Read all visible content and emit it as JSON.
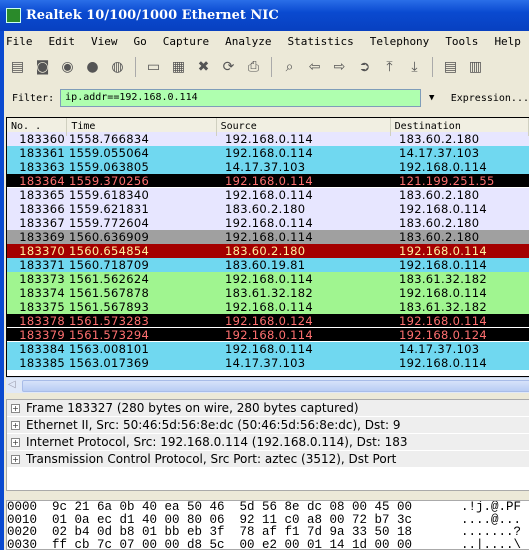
{
  "window": {
    "title": "Realtek 10/100/1000 Ethernet NIC"
  },
  "menu": [
    "File",
    "Edit",
    "View",
    "Go",
    "Capture",
    "Analyze",
    "Statistics",
    "Telephony",
    "Tools",
    "Help"
  ],
  "toolbar": [
    {
      "icon": "interfaces-icon",
      "g": "▤"
    },
    {
      "icon": "capture-options-icon",
      "g": "◙"
    },
    {
      "icon": "start-capture-icon",
      "g": "◉"
    },
    {
      "icon": "stop-capture-icon",
      "g": "●"
    },
    {
      "icon": "restart-capture-icon",
      "g": "◍"
    },
    {
      "sep": true
    },
    {
      "icon": "open-icon",
      "g": "▭"
    },
    {
      "icon": "save-icon",
      "g": "▦"
    },
    {
      "icon": "close-icon",
      "g": "✖"
    },
    {
      "icon": "reload-icon",
      "g": "⟳"
    },
    {
      "icon": "print-icon",
      "g": "⎙"
    },
    {
      "sep": true
    },
    {
      "icon": "find-icon",
      "g": "⌕"
    },
    {
      "icon": "back-icon",
      "g": "⇦"
    },
    {
      "icon": "forward-icon",
      "g": "⇨"
    },
    {
      "icon": "go-to-packet-icon",
      "g": "➲"
    },
    {
      "icon": "first-packet-icon",
      "g": "⤒"
    },
    {
      "icon": "last-packet-icon",
      "g": "⤓"
    },
    {
      "sep": true
    },
    {
      "icon": "colorize-icon",
      "g": "▤"
    },
    {
      "icon": "autoscroll-icon",
      "g": "▥"
    }
  ],
  "filter": {
    "label": "Filter:",
    "value": "ip.addr==192.168.0.114",
    "expression": "Expression..."
  },
  "columns": [
    "No. .",
    "Time",
    "Source",
    "Destination"
  ],
  "colors": {
    "tcp": "#e7e6ff",
    "udp": "#70d8f0",
    "black": "#000000",
    "black_text": "#ff7070",
    "gray": "#a0a0a0",
    "darkred": "#a40000",
    "darkred_text": "#fff0a0",
    "green": "#a0f590"
  },
  "packets": [
    {
      "no": "183360",
      "time": "1558.766834",
      "src": "192.168.0.114",
      "dst": "183.60.2.180",
      "style": "tcp"
    },
    {
      "no": "183361",
      "time": "1559.055064",
      "src": "192.168.0.114",
      "dst": "14.17.37.103",
      "style": "udp"
    },
    {
      "no": "183363",
      "time": "1559.063805",
      "src": "14.17.37.103",
      "dst": "192.168.0.114",
      "style": "udp"
    },
    {
      "no": "183364",
      "time": "1559.370256",
      "src": "192.168.0.114",
      "dst": "121.199.251.55",
      "style": "black"
    },
    {
      "no": "183365",
      "time": "1559.618340",
      "src": "192.168.0.114",
      "dst": "183.60.2.180",
      "style": "tcp"
    },
    {
      "no": "183366",
      "time": "1559.621831",
      "src": "183.60.2.180",
      "dst": "192.168.0.114",
      "style": "tcp"
    },
    {
      "no": "183367",
      "time": "1559.772604",
      "src": "192.168.0.114",
      "dst": "183.60.2.180",
      "style": "tcp"
    },
    {
      "no": "183369",
      "time": "1560.636909",
      "src": "192.168.0.114",
      "dst": "183.60.2.180",
      "style": "gray"
    },
    {
      "no": "183370",
      "time": "1560.654854",
      "src": "183.60.2.180",
      "dst": "192.168.0.114",
      "style": "darkred"
    },
    {
      "no": "183371",
      "time": "1560.718709",
      "src": "183.60.19.81",
      "dst": "192.168.0.114",
      "style": "udp"
    },
    {
      "no": "183373",
      "time": "1561.562624",
      "src": "192.168.0.114",
      "dst": "183.61.32.182",
      "style": "green"
    },
    {
      "no": "183374",
      "time": "1561.567878",
      "src": "183.61.32.182",
      "dst": "192.168.0.114",
      "style": "green"
    },
    {
      "no": "183375",
      "time": "1561.567893",
      "src": "192.168.0.114",
      "dst": "183.61.32.182",
      "style": "green"
    },
    {
      "no": "183378",
      "time": "1561.573283",
      "src": "192.168.0.124",
      "dst": "192.168.0.114",
      "style": "black"
    },
    {
      "no": "183379",
      "time": "1561.573294",
      "src": "192.168.0.114",
      "dst": "192.168.0.124",
      "style": "black"
    },
    {
      "no": "183384",
      "time": "1563.008101",
      "src": "192.168.0.114",
      "dst": "14.17.37.103",
      "style": "udp"
    },
    {
      "no": "183385",
      "time": "1563.017369",
      "src": "14.17.37.103",
      "dst": "192.168.0.114",
      "style": "udp"
    }
  ],
  "details": [
    "Frame 183327 (280 bytes on wire, 280 bytes captured)",
    "Ethernet II, Src: 50:46:5d:56:8e:dc (50:46:5d:56:8e:dc), Dst: 9",
    "Internet Protocol, Src: 192.168.0.114 (192.168.0.114), Dst: 183",
    "Transmission Control Protocol, Src Port: aztec (3512), Dst Port"
  ],
  "bytes": [
    {
      "off": "0000",
      "hex": "9c 21 6a 0b 40 ea 50 46  5d 56 8e dc 08 00 45 00",
      "ascii": ".!j.@.PF"
    },
    {
      "off": "0010",
      "hex": "01 0a ec d1 40 00 80 06  92 11 c0 a8 00 72 b7 3c",
      "ascii": "....@..."
    },
    {
      "off": "0020",
      "hex": "02 b4 0d b8 01 bb eb 3f  78 af f1 7d 9a 33 50 18",
      "ascii": ".......?"
    },
    {
      "off": "0030",
      "hex": "ff cb 7c 07 00 00 d8 5c  00 e2 00 01 14 1d 00 00",
      "ascii": "..|....\\"
    }
  ]
}
